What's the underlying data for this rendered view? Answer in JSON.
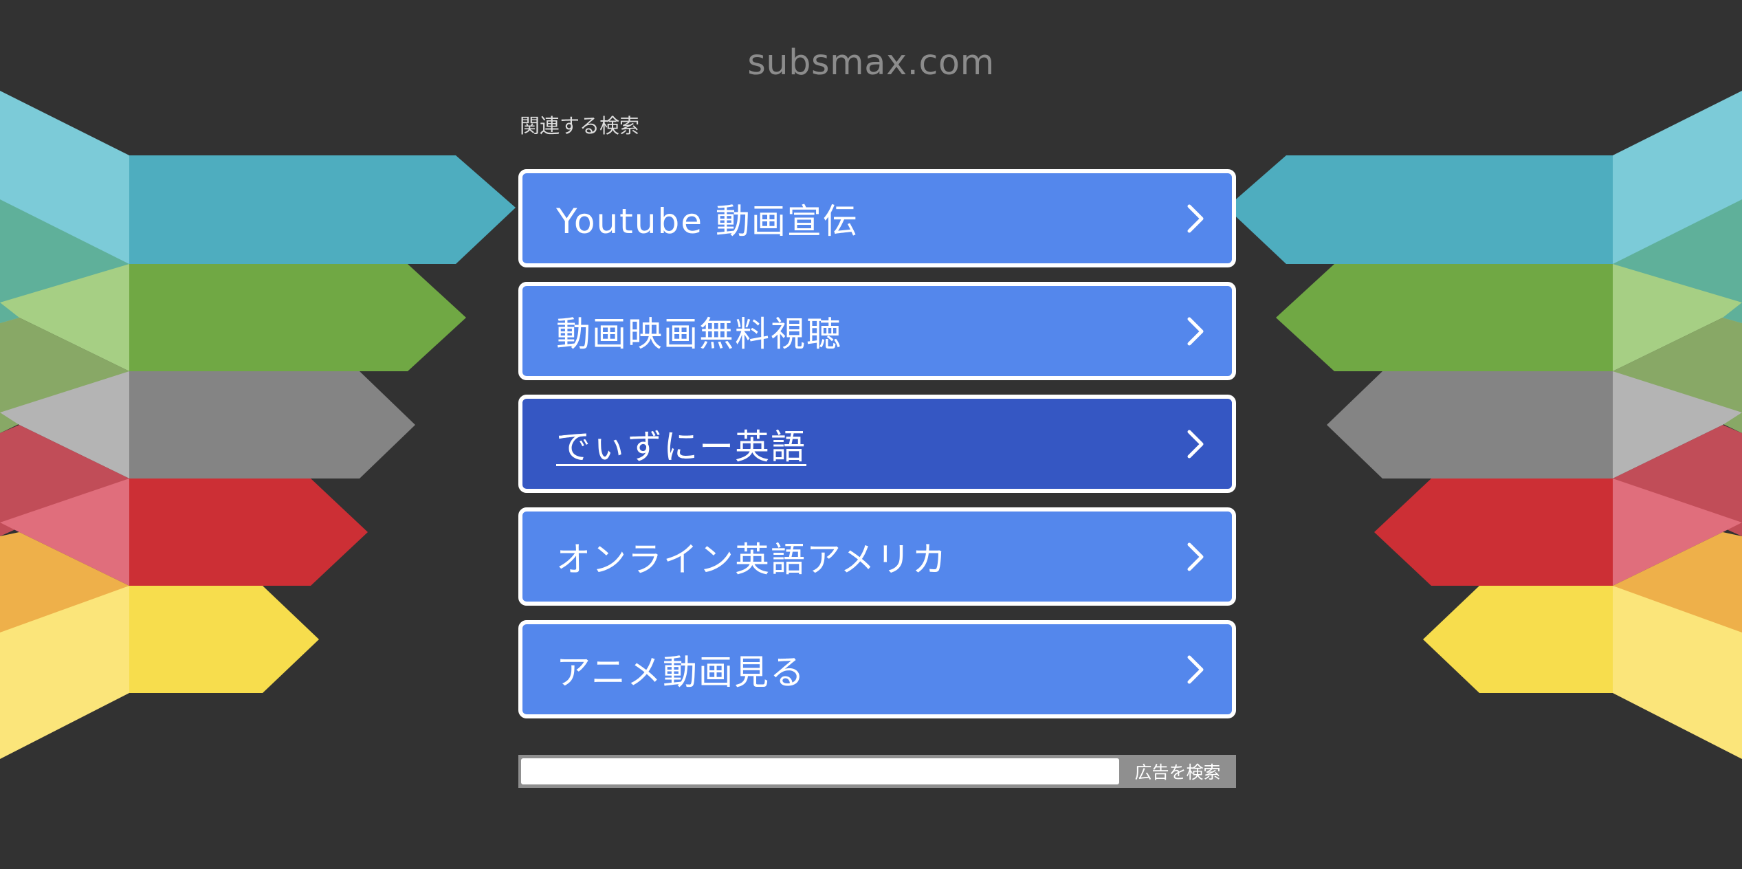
{
  "site": {
    "domain": "subsmax.com"
  },
  "related_heading": "関連する検索",
  "links": [
    {
      "label": "Youtube 動画宣伝"
    },
    {
      "label": "動画映画無料視聴"
    },
    {
      "label": "でぃずにー英語"
    },
    {
      "label": "オンライン英語アメリカ"
    },
    {
      "label": "アニメ動画見る"
    }
  ],
  "search": {
    "value": "",
    "button_label": "広告を検索"
  },
  "colors": {
    "background": "#323232",
    "link_button": "#5487ec",
    "link_button_active": "#3557c3",
    "ribbon_teal": "#4eadbf",
    "ribbon_green": "#70a844",
    "ribbon_gray": "#848484",
    "ribbon_red": "#cc2f35",
    "ribbon_yellow": "#f7dd4d"
  },
  "icons": {
    "link_arrow": "chevron-right-icon"
  }
}
